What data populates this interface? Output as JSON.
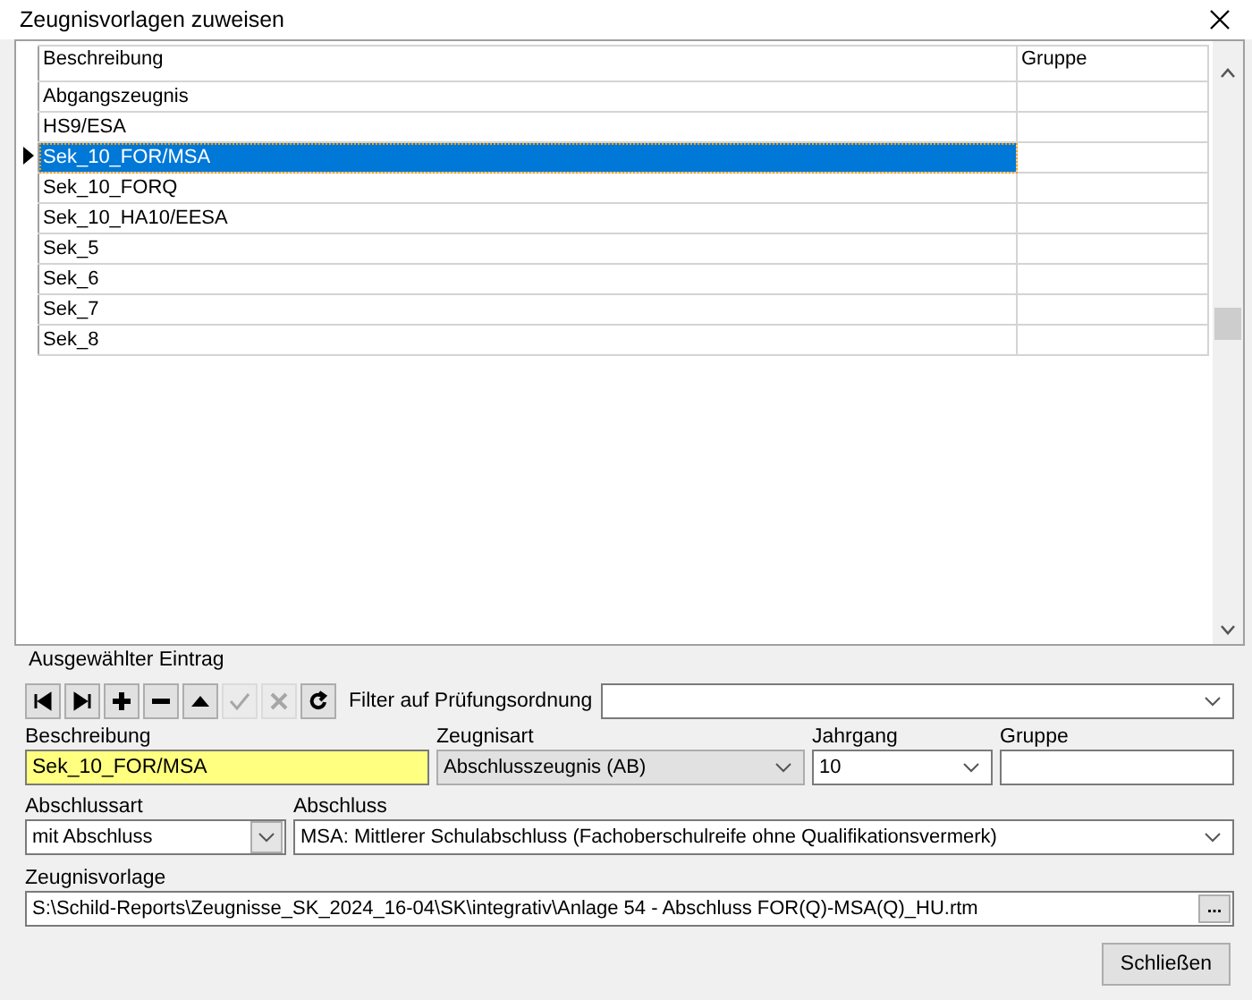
{
  "window": {
    "title": "Zeugnisvorlagen zuweisen"
  },
  "table": {
    "columns": [
      "Beschreibung",
      "Gruppe"
    ],
    "rows": [
      {
        "beschreibung": "Abgangszeugnis",
        "selected": false
      },
      {
        "beschreibung": "HS9/ESA",
        "selected": false
      },
      {
        "beschreibung": "Sek_10_FOR/MSA",
        "selected": true
      },
      {
        "beschreibung": "Sek_10_FORQ",
        "selected": false
      },
      {
        "beschreibung": "Sek_10_HA10/EESA",
        "selected": false
      },
      {
        "beschreibung": "Sek_5",
        "selected": false
      },
      {
        "beschreibung": "Sek_6",
        "selected": false
      },
      {
        "beschreibung": "Sek_7",
        "selected": false
      },
      {
        "beschreibung": "Sek_8",
        "selected": false
      }
    ]
  },
  "entry": {
    "group_label": "Ausgewählter Eintrag",
    "toolbar": [
      {
        "kind": "first",
        "disabled": false
      },
      {
        "kind": "last",
        "disabled": false
      },
      {
        "kind": "add",
        "disabled": false
      },
      {
        "kind": "delete",
        "disabled": false
      },
      {
        "kind": "up",
        "disabled": false
      },
      {
        "kind": "post",
        "disabled": true
      },
      {
        "kind": "cancel",
        "disabled": true
      },
      {
        "kind": "refresh",
        "disabled": false
      }
    ],
    "filter_label": "Filter auf Prüfungsordnung",
    "beschreibung": {
      "label": "Beschreibung",
      "value": "Sek_10_FOR/MSA"
    },
    "zeugnisart": {
      "label": "Zeugnisart",
      "value": "Abschlusszeugnis (AB)",
      "disabled": true
    },
    "jahrgang": {
      "label": "Jahrgang",
      "value": "10"
    },
    "gruppe": {
      "label": "Gruppe"
    },
    "abschlussart": {
      "label": "Abschlussart",
      "value": "mit Abschluss"
    },
    "abschluss": {
      "label": "Abschluss",
      "value": "MSA: Mittlerer Schulabschluss (Fachoberschulreife ohne Qualifikationsvermerk)"
    },
    "zeugnisvorlage": {
      "label": "Zeugnisvorlage",
      "value": "S:\\Schild-Reports\\Zeugnisse_SK_2024_16-04\\SK\\integrativ\\Anlage 54 - Abschluss FOR(Q)-MSA(Q)_HU.rtm",
      "button": "..."
    }
  },
  "buttons": [
    "Schließen"
  ]
}
